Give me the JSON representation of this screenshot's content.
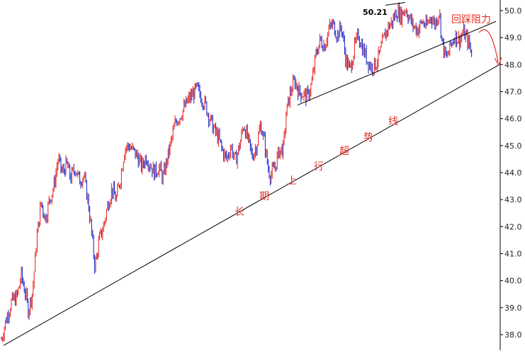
{
  "chart_data": {
    "type": "candlestick-line",
    "title": "",
    "xlabel": "",
    "ylabel": "",
    "ylim": [
      37.7,
      50.3
    ],
    "yticks": [
      "50.0",
      "49.0",
      "48.0",
      "47.0",
      "46.0",
      "45.0",
      "44.0",
      "43.0",
      "42.0",
      "41.0",
      "40.0",
      "39.0",
      "38.0"
    ],
    "grid": false,
    "colors": {
      "up": "#e8302a",
      "down": "#2233cc",
      "line": "#000000",
      "annotation": "#e8302a"
    },
    "price_path": [
      [
        0,
        37.6
      ],
      [
        8,
        38.5
      ],
      [
        16,
        39.2
      ],
      [
        24,
        39.4
      ],
      [
        30,
        40.2
      ],
      [
        36,
        39.5
      ],
      [
        40,
        38.9
      ],
      [
        46,
        39.6
      ],
      [
        52,
        41.6
      ],
      [
        58,
        42.9
      ],
      [
        64,
        42.3
      ],
      [
        70,
        43.0
      ],
      [
        76,
        43.5
      ],
      [
        82,
        44.5
      ],
      [
        88,
        44.0
      ],
      [
        94,
        44.3
      ],
      [
        100,
        43.8
      ],
      [
        106,
        44.2
      ],
      [
        112,
        43.7
      ],
      [
        118,
        43.9
      ],
      [
        124,
        43.0
      ],
      [
        128,
        42.1
      ],
      [
        134,
        40.5
      ],
      [
        140,
        41.5
      ],
      [
        146,
        42.0
      ],
      [
        152,
        42.8
      ],
      [
        158,
        43.4
      ],
      [
        164,
        43.0
      ],
      [
        170,
        43.8
      ],
      [
        176,
        44.9
      ],
      [
        182,
        45.0
      ],
      [
        188,
        44.8
      ],
      [
        194,
        44.6
      ],
      [
        200,
        44.2
      ],
      [
        206,
        44.6
      ],
      [
        212,
        44.3
      ],
      [
        218,
        44.0
      ],
      [
        224,
        44.2
      ],
      [
        230,
        43.8
      ],
      [
        236,
        44.5
      ],
      [
        242,
        45.2
      ],
      [
        248,
        45.9
      ],
      [
        254,
        46.1
      ],
      [
        260,
        46.4
      ],
      [
        266,
        46.7
      ],
      [
        272,
        46.9
      ],
      [
        278,
        47.1
      ],
      [
        284,
        46.8
      ],
      [
        290,
        46.5
      ],
      [
        296,
        46.0
      ],
      [
        302,
        45.6
      ],
      [
        308,
        45.3
      ],
      [
        314,
        44.8
      ],
      [
        320,
        44.5
      ],
      [
        326,
        45.0
      ],
      [
        332,
        44.4
      ],
      [
        338,
        45.0
      ],
      [
        344,
        45.8
      ],
      [
        350,
        45.2
      ],
      [
        356,
        44.6
      ],
      [
        362,
        45.0
      ],
      [
        368,
        45.8
      ],
      [
        374,
        45.0
      ],
      [
        378,
        44.2
      ],
      [
        382,
        43.9
      ],
      [
        388,
        44.2
      ],
      [
        394,
        44.8
      ],
      [
        400,
        44.9
      ],
      [
        404,
        46.2
      ],
      [
        410,
        47.0
      ],
      [
        416,
        47.4
      ],
      [
        422,
        47.0
      ],
      [
        428,
        46.9
      ],
      [
        434,
        46.8
      ],
      [
        440,
        47.3
      ],
      [
        446,
        48.4
      ],
      [
        452,
        48.9
      ],
      [
        458,
        48.7
      ],
      [
        464,
        49.3
      ],
      [
        470,
        49.5
      ],
      [
        476,
        49.1
      ],
      [
        482,
        49.4
      ],
      [
        488,
        48.2
      ],
      [
        494,
        47.8
      ],
      [
        500,
        48.6
      ],
      [
        506,
        49.1
      ],
      [
        512,
        48.6
      ],
      [
        518,
        48.2
      ],
      [
        524,
        47.9
      ],
      [
        530,
        48.0
      ],
      [
        536,
        48.4
      ],
      [
        542,
        49.0
      ],
      [
        548,
        49.4
      ],
      [
        554,
        49.6
      ],
      [
        560,
        50.0
      ],
      [
        566,
        49.8
      ],
      [
        572,
        50.1
      ],
      [
        578,
        49.7
      ],
      [
        584,
        49.4
      ],
      [
        590,
        49.3
      ],
      [
        596,
        49.6
      ],
      [
        602,
        49.4
      ],
      [
        608,
        49.8
      ],
      [
        614,
        49.5
      ],
      [
        620,
        50.0
      ],
      [
        624,
        48.8
      ],
      [
        630,
        48.2
      ],
      [
        636,
        48.7
      ],
      [
        642,
        49.1
      ],
      [
        648,
        48.9
      ],
      [
        654,
        49.2
      ],
      [
        660,
        48.9
      ],
      [
        666,
        48.4
      ]
    ],
    "trendlines": [
      {
        "name": "long-term-uptrend",
        "from": [
          5,
          37.6
        ],
        "to": [
          705,
          48.0
        ]
      },
      {
        "name": "upper-support",
        "from": [
          420,
          46.5
        ],
        "to": [
          700,
          49.6
        ]
      },
      {
        "name": "peak-callout",
        "from": [
          544,
          50.2
        ],
        "to": [
          572,
          50.3
        ]
      }
    ],
    "annotations": {
      "peak_label": "50.21",
      "resistance_label": "回踩阻力",
      "trend_chars": [
        "长",
        "期",
        "上",
        "行",
        "超",
        "势",
        "线"
      ]
    }
  }
}
